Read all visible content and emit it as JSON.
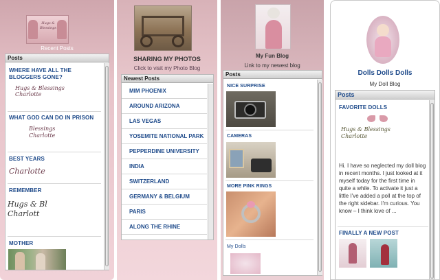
{
  "widget1": {
    "caption": "Recent Posts",
    "logo_text": "Hugs & Blessings",
    "header": "Posts",
    "posts": [
      {
        "title": "WHERE HAVE ALL THE BLOGGERS GONE?",
        "signature": "Hugs & Blessings Charlotte"
      },
      {
        "title": "WHAT GOD CAN DO IN PRISON",
        "signature": "Blessings Charlotte"
      },
      {
        "title": "BEST YEARS",
        "signature": "Charlotte"
      },
      {
        "title": "REMEMBER",
        "signature": "Hugs & Bl Charlott"
      },
      {
        "title": "MOTHER",
        "signature": ""
      }
    ]
  },
  "widget2": {
    "title": "SHARING MY PHOTOS",
    "subtitle": "Click to visit my Photo Blog",
    "header": "Newest Posts",
    "links": [
      "MIM PHOENIX",
      "AROUND ARIZONA",
      "LAS VEGAS",
      "YOSEMITE NATIONAL PARK",
      "PEPPERDINE UNIVERSITY",
      "INDIA",
      "SWITZERLAND",
      "GERMANY & BELGIUM",
      "PARIS",
      "ALONG THE RHINE"
    ]
  },
  "widget3": {
    "title": "My Fun Blog",
    "subtitle": "Link to my newest blog",
    "header": "Posts",
    "posts": [
      "NICE SURPRISE",
      "CAMERAS",
      "MORE PINK RINGS",
      "My Dolls"
    ]
  },
  "widget4": {
    "title": "Dolls Dolls Dolls",
    "subtitle": "My Doll Blog",
    "header": "Posts",
    "post1_title": "FAVORITE DOLLS",
    "signature": "Hugs & Blessings Charlotte",
    "body": "Hi. I have so neglected my doll blog in recent months. I just looked at it myself today for the first time in quite a while. To activate it just a little I've added a poll at the top of the right sidebar. I'm curious. You know – I think love of ...",
    "post2_title": "FINALLY A NEW POST"
  },
  "colors": {
    "link_blue": "#1e4a8a",
    "pink_bg": "#e7c3c9"
  }
}
